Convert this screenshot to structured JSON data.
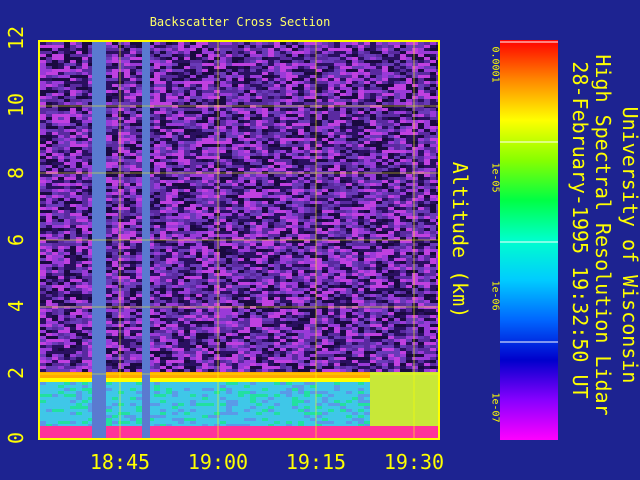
{
  "chart_data": {
    "type": "heatmap",
    "title": "Backscatter Cross Section",
    "ylabel": "Altitude (km)",
    "xlabel": "",
    "y_ticks": [
      "0",
      "2",
      "4",
      "6",
      "8",
      "10",
      "12"
    ],
    "x_ticks": [
      "18:45",
      "19:00",
      "19:15",
      "19:30"
    ],
    "ylim": [
      0,
      12
    ],
    "colorbar": {
      "ticks": [
        "0.0001",
        "1e-05",
        "1e-06",
        "1e-07"
      ],
      "colors": [
        "#ff0000",
        "#ff8800",
        "#ffff00",
        "#88ff00",
        "#00ff44",
        "#00ffcc",
        "#00ccff",
        "#0066ff",
        "#0000cc",
        "#8800ff",
        "#ff00ff"
      ]
    },
    "grid": true
  },
  "side_text": {
    "line1": "University of Wisconsin",
    "line2": "High Spectral Resolution Lidar",
    "line3": "28-February-1995 19:32:50 UT"
  },
  "colors": {
    "background": "#1d2391",
    "axes": "#ffff00",
    "grid": "#ffff00"
  }
}
